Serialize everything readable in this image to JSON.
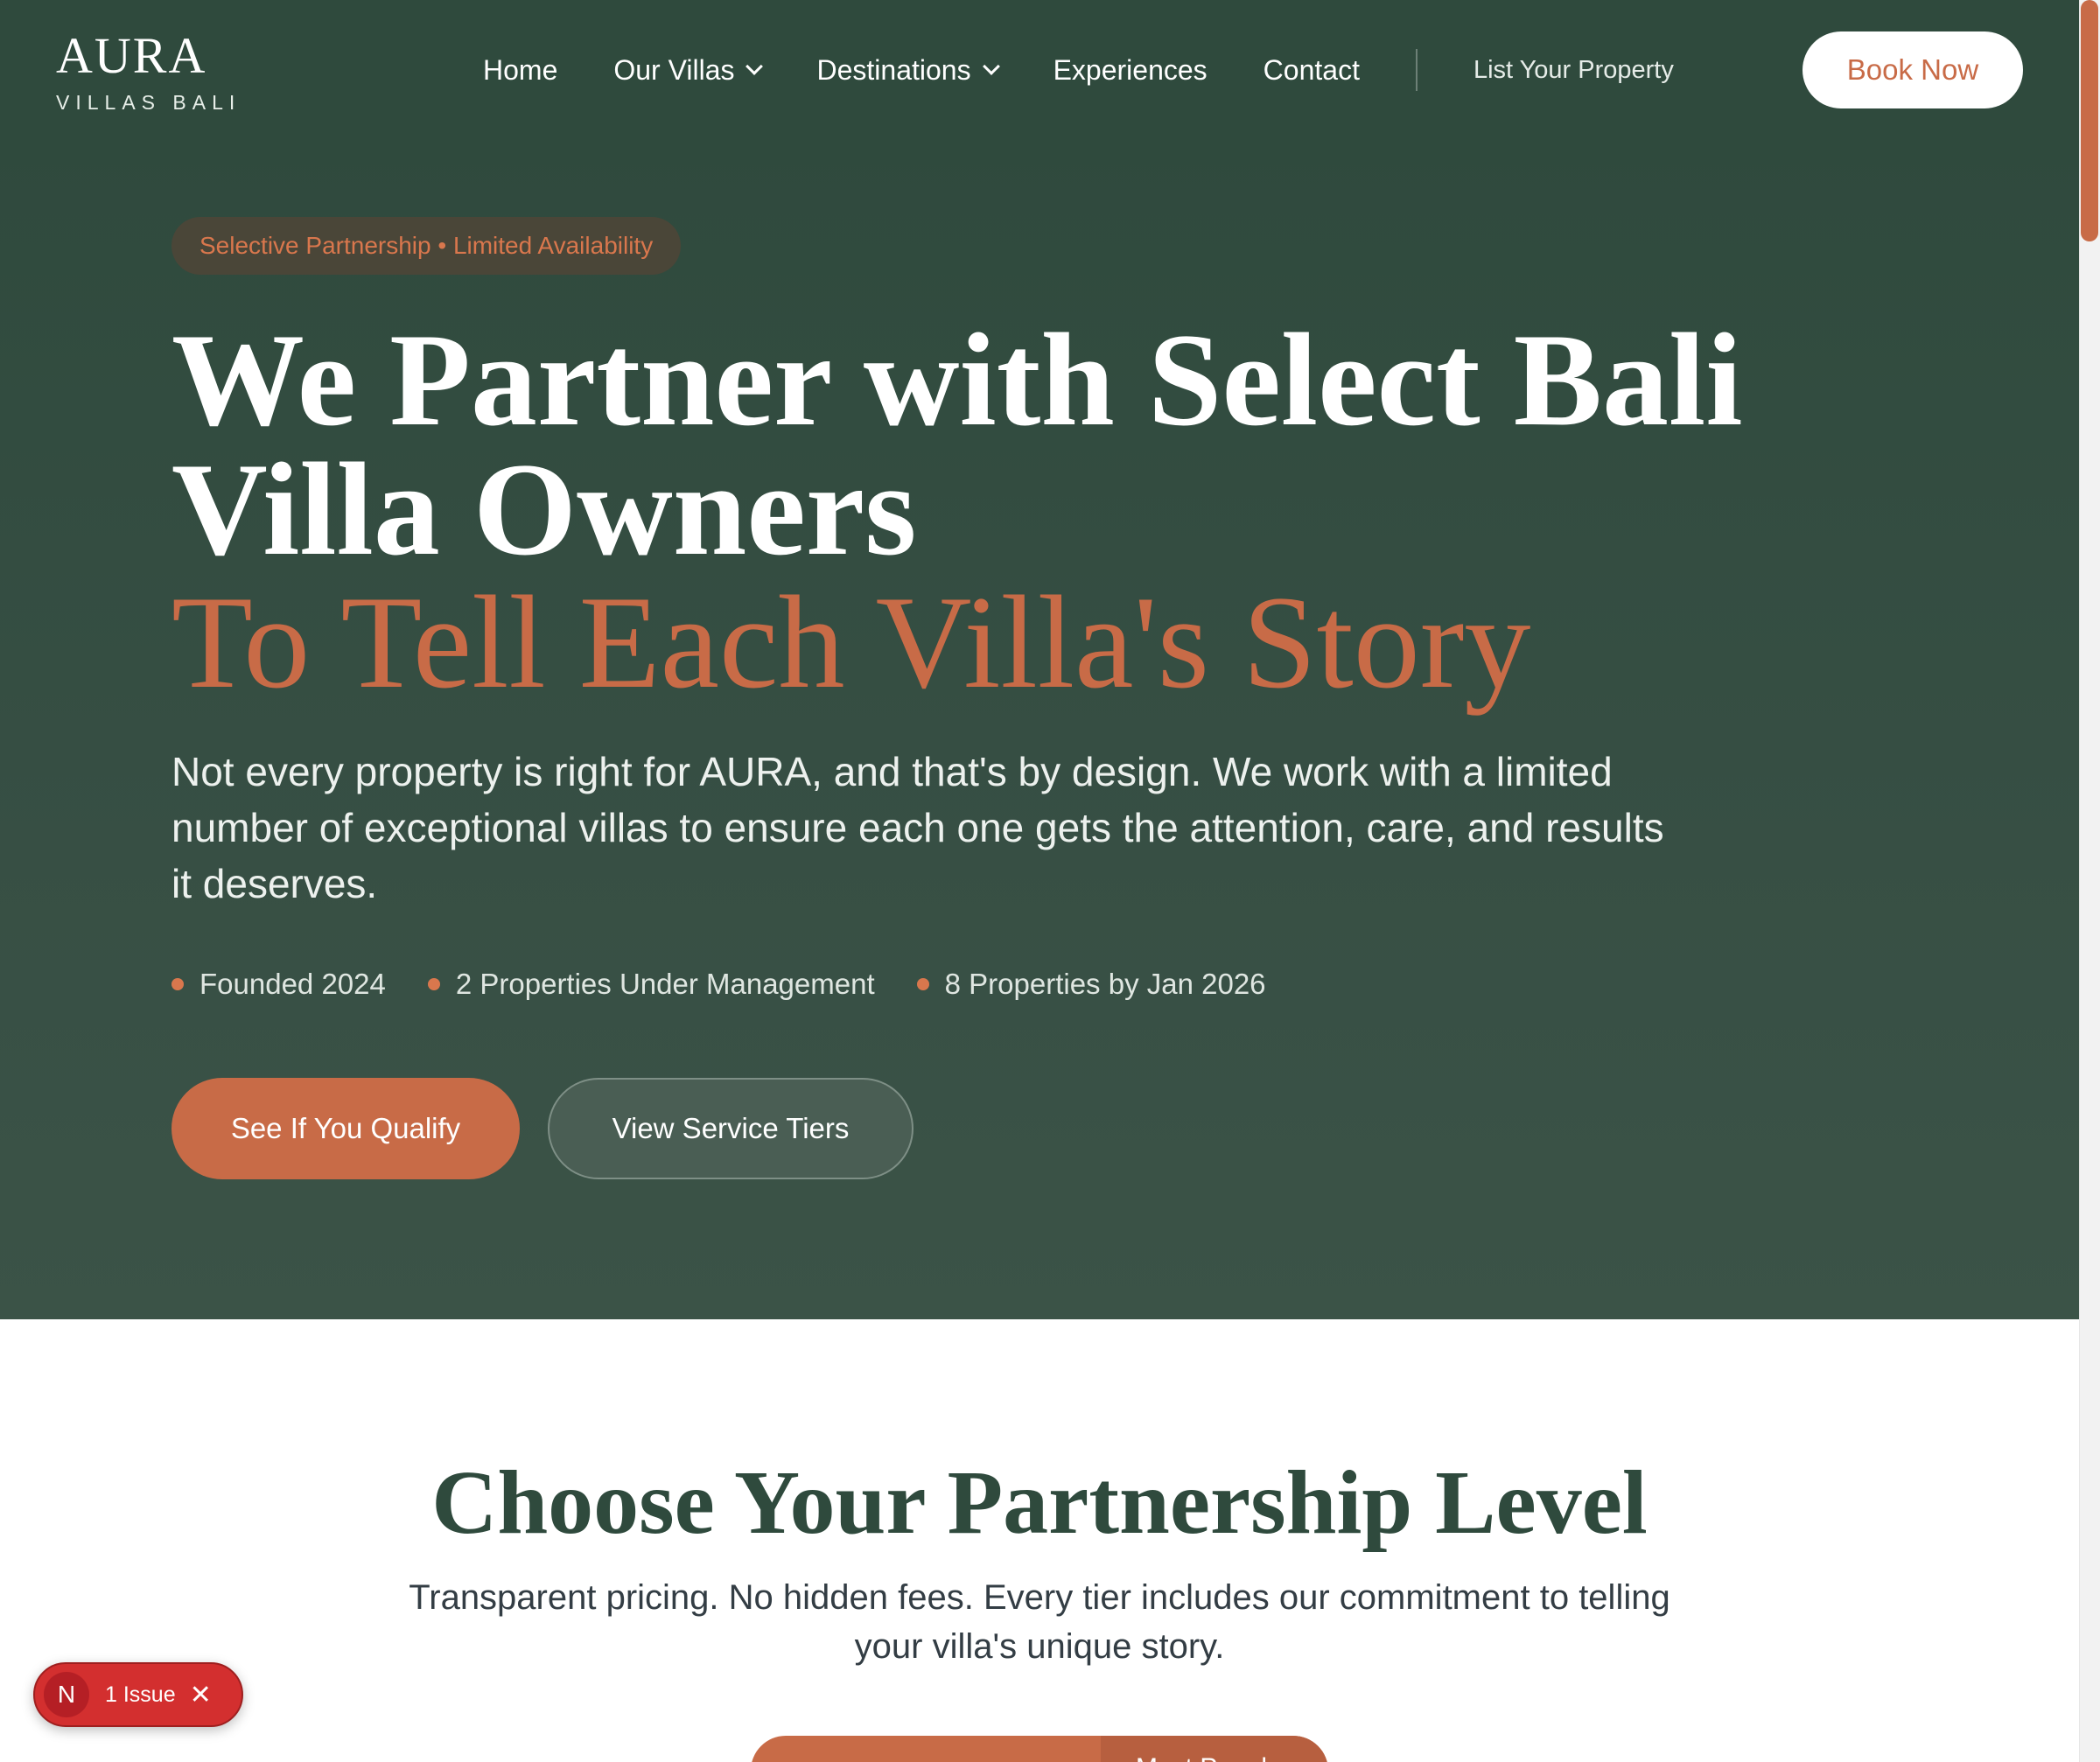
{
  "brand": {
    "name": "AURA",
    "tagline": "VILLAS BALI"
  },
  "nav": {
    "items": [
      {
        "label": "Home"
      },
      {
        "label": "Our Villas"
      },
      {
        "label": "Destinations"
      },
      {
        "label": "Experiences"
      },
      {
        "label": "Contact"
      }
    ],
    "list_property": "List Your Property",
    "book_now": "Book Now"
  },
  "hero": {
    "badge": "Selective Partnership • Limited Availability",
    "title": "We Partner with Select Bali Villa Owners",
    "title_accent": "To Tell Each Villa's Story",
    "description": "Not every property is right for AURA, and that's by design. We work with a limited number of exceptional villas to ensure each one gets the attention, care, and results it deserves.",
    "stats": [
      {
        "label": "Founded 2024"
      },
      {
        "label": "2 Properties Under Management"
      },
      {
        "label": "8 Properties by Jan 2026"
      }
    ],
    "cta_primary": "See If You Qualify",
    "cta_secondary": "View Service Tiers"
  },
  "partnership": {
    "title": "Choose Your Partnership Level",
    "description": "Transparent pricing. No hidden fees. Every tier includes our commitment to telling your villa's unique story.",
    "toggle_right": "Most Popular"
  },
  "issue_badge": {
    "logo": "N",
    "label": "1 Issue"
  },
  "colors": {
    "brand_green": "#2f4a3d",
    "accent": "#c86b47",
    "issue_red": "#d32f2f"
  }
}
